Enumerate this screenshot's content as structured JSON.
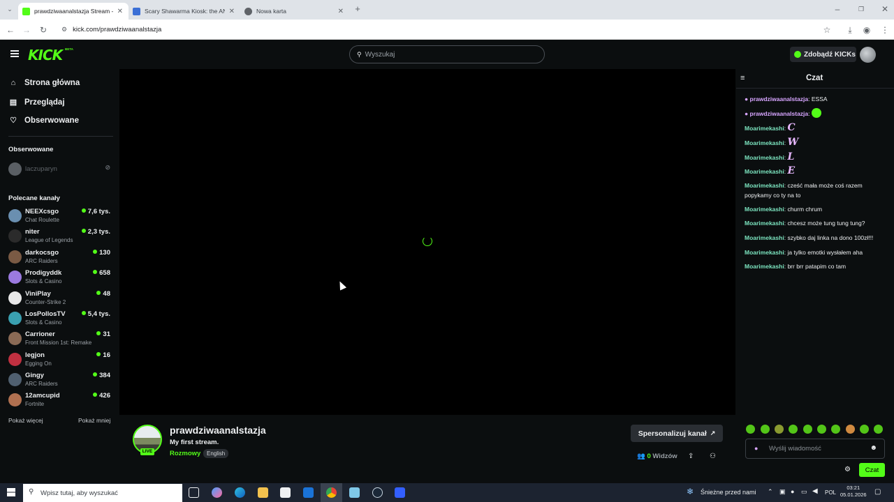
{
  "browser": {
    "tabs": [
      {
        "label": "prawdziwaanalstazja Stream - V",
        "active": true,
        "favicon_color": "#53fc18"
      },
      {
        "label": "Scary Shawarma Kiosk: the ANO",
        "active": false,
        "favicon_color": "#3b6fd6"
      },
      {
        "label": "Nowa karta",
        "active": false,
        "favicon_color": "#5f6368"
      }
    ],
    "new_tab": "+",
    "url": "kick.com/prawdziwaanalstazja"
  },
  "header": {
    "logo": "KICK",
    "logo_badge": "BETA",
    "search_placeholder": "Wyszukaj",
    "kicks_button": "Zdobądź KICKs"
  },
  "sidebar": {
    "nav": [
      {
        "label": "Strona główna",
        "icon": "home-icon"
      },
      {
        "label": "Przeglądaj",
        "icon": "browse-icon"
      },
      {
        "label": "Obserwowane",
        "icon": "heart-icon"
      }
    ],
    "followed_title": "Obserwowane",
    "followed": [
      {
        "name": "laczuparyn"
      }
    ],
    "recommended_title": "Polecane kanały",
    "recommended": [
      {
        "name": "NEEXcsgo",
        "category": "Chat Roulette",
        "viewers": "7,6 tys.",
        "color": "#6a8fb0"
      },
      {
        "name": "niter",
        "category": "League of Legends",
        "viewers": "2,3 tys.",
        "color": "#2b2b2b"
      },
      {
        "name": "darkocsgo",
        "category": "ARC Raiders",
        "viewers": "130",
        "color": "#7a5a44"
      },
      {
        "name": "Prodigyddk",
        "category": "Slots & Casino",
        "viewers": "658",
        "color": "#9b7ae0"
      },
      {
        "name": "ViniPlay",
        "category": "Counter-Strike 2",
        "viewers": "48",
        "color": "#e8e8e8"
      },
      {
        "name": "LosPollosTV",
        "category": "Slots & Casino",
        "viewers": "5,4 tys.",
        "color": "#3aa0b0"
      },
      {
        "name": "Carrioner",
        "category": "Front Mission 1st: Remake",
        "viewers": "31",
        "color": "#8a6a55"
      },
      {
        "name": "legjon",
        "category": "Egging On",
        "viewers": "16",
        "color": "#c03040"
      },
      {
        "name": "Gingy",
        "category": "ARC Raiders",
        "viewers": "384",
        "color": "#506070"
      },
      {
        "name": "12amcupid",
        "category": "Fortnite",
        "viewers": "426",
        "color": "#b07050"
      }
    ],
    "show_more": "Pokaż więcej",
    "show_less": "Pokaż mniej"
  },
  "stream": {
    "streamer": "prawdziwaanalstazja",
    "title": "My first stream.",
    "category": "Rozmowy",
    "language": "English",
    "live_badge": "LIVE",
    "personalize_button": "Spersonalizuj kanał",
    "viewers_count": "0",
    "viewers_label": "Widzów"
  },
  "chat": {
    "title": "Czat",
    "messages": [
      {
        "user": "prawdziwaanalstazja",
        "type": "mod",
        "text": "ESSA",
        "emote": ""
      },
      {
        "user": "prawdziwaanalstazja",
        "type": "mod",
        "text": "",
        "emote": "green"
      },
      {
        "user": "Moarimekashi",
        "type": "norm",
        "text": "",
        "emote": "C"
      },
      {
        "user": "Moarimekashi",
        "type": "norm",
        "text": "",
        "emote": "W"
      },
      {
        "user": "Moarimekashi",
        "type": "norm",
        "text": "",
        "emote": "L"
      },
      {
        "user": "Moarimekashi",
        "type": "norm",
        "text": "",
        "emote": "E"
      },
      {
        "user": "Moarimekashi",
        "type": "norm",
        "text": "cześć mała może coś razem popykamy co ty na to",
        "emote": ""
      },
      {
        "user": "Moarimekashi",
        "type": "norm",
        "text": "churm chrum",
        "emote": ""
      },
      {
        "user": "Moarimekashi",
        "type": "norm",
        "text": "chcesz może tung tung tung?",
        "emote": ""
      },
      {
        "user": "Moarimekashi",
        "type": "norm",
        "text": "szybko daj linka na dono 100zł!!!",
        "emote": ""
      },
      {
        "user": "Moarimekashi",
        "type": "norm",
        "text": "ja tylko emotki wysłałem aha",
        "emote": ""
      },
      {
        "user": "Moarimekashi",
        "type": "norm",
        "text": "brr brr patapim co tam",
        "emote": ""
      }
    ],
    "input_placeholder": "Wyślij wiadomość",
    "send_button": "Czat"
  },
  "taskbar": {
    "search_placeholder": "Wpisz tutaj, aby wyszukać",
    "weather": "Śnieżne przed nami",
    "language": "POL",
    "time": "03:21",
    "date": "05.01.2026"
  },
  "colors": {
    "accent": "#53fc18",
    "background": "#0b0e0f"
  }
}
